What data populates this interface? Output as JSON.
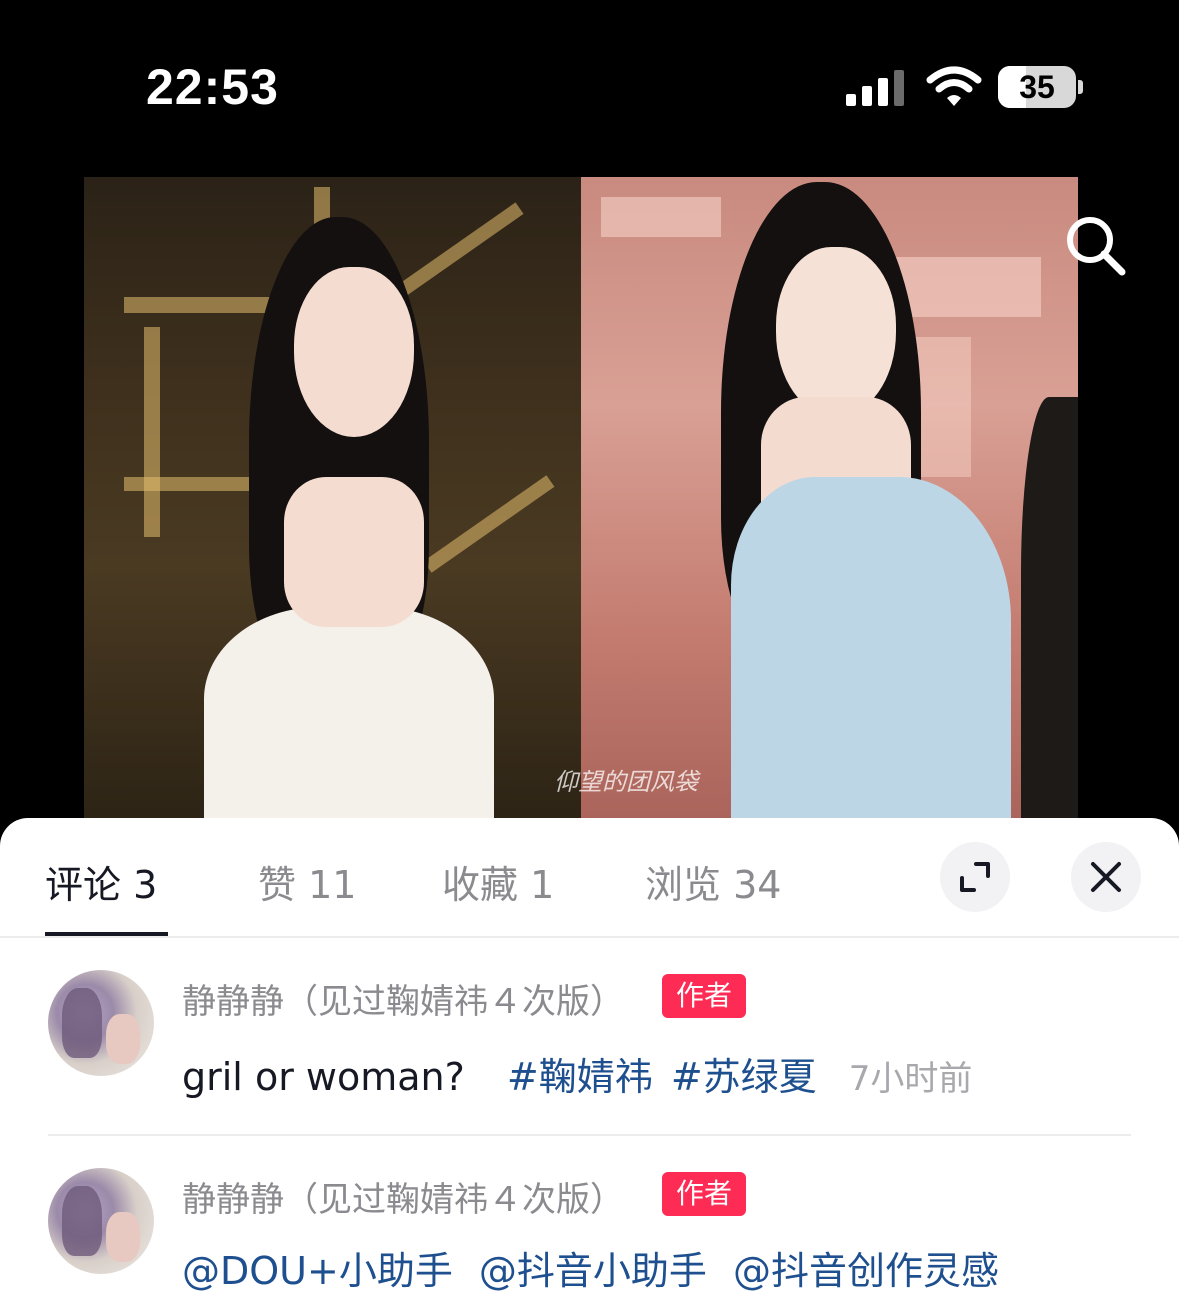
{
  "status_bar": {
    "time": "22:53",
    "battery_level": "35",
    "signal_icon": "cellular-signal-icon",
    "wifi_icon": "wifi-icon"
  },
  "media": {
    "watermark": "仰望的团风袋",
    "zoom_icon": "search-zoom-icon"
  },
  "sheet": {
    "tabs": [
      {
        "label": "评论 3",
        "active": true
      },
      {
        "label": "赞 11",
        "active": false
      },
      {
        "label": "收藏 1",
        "active": false
      },
      {
        "label": "浏览 34",
        "active": false
      }
    ],
    "expand_icon": "expand-icon",
    "close_icon": "close-icon"
  },
  "comments": [
    {
      "username": "静静静（见过鞠婧祎４次版）",
      "badge": "作者",
      "text": "gril or woman?",
      "hashtags": [
        "#鞠婧祎",
        "#苏绿夏"
      ],
      "time": "7小时前"
    },
    {
      "username": "静静静（见过鞠婧祎４次版）",
      "badge": "作者",
      "mentions": [
        "@DOU+小助手",
        "@抖音小助手",
        "@抖音创作灵感"
      ]
    }
  ],
  "colors": {
    "accent_red": "#fe2c55",
    "link_blue": "#1e4f8f",
    "text_primary": "#161823",
    "text_secondary": "#8a8a8f"
  }
}
